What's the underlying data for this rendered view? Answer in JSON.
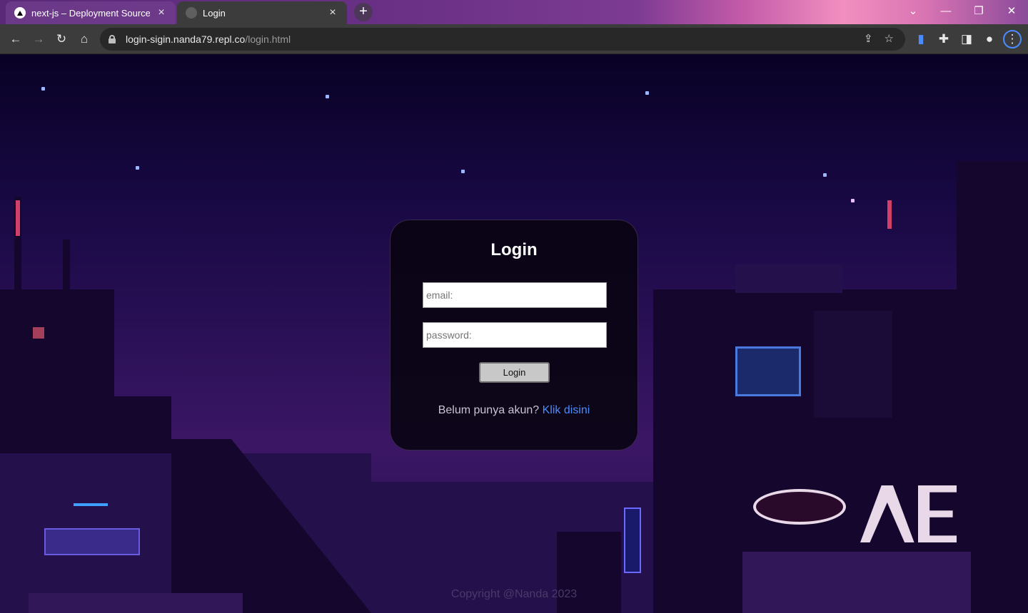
{
  "browser": {
    "tabs": [
      {
        "title": "next-js – Deployment Source",
        "active": false
      },
      {
        "title": "Login",
        "active": true
      }
    ],
    "url_host": "login-sigin.nanda79.repl.co",
    "url_path": "/login.html",
    "new_tab_label": "+",
    "close_label": "×"
  },
  "login": {
    "title": "Login",
    "email_placeholder": "email:",
    "password_placeholder": "password:",
    "button_label": "Login",
    "signup_prompt": "Belum punya akun?",
    "signup_link": "Klik disini"
  },
  "footer": {
    "text": "Copyright @Nanda 2023"
  },
  "colors": {
    "link": "#4a8cff",
    "card_bg": "#0a0412",
    "background": "#2a1056"
  }
}
